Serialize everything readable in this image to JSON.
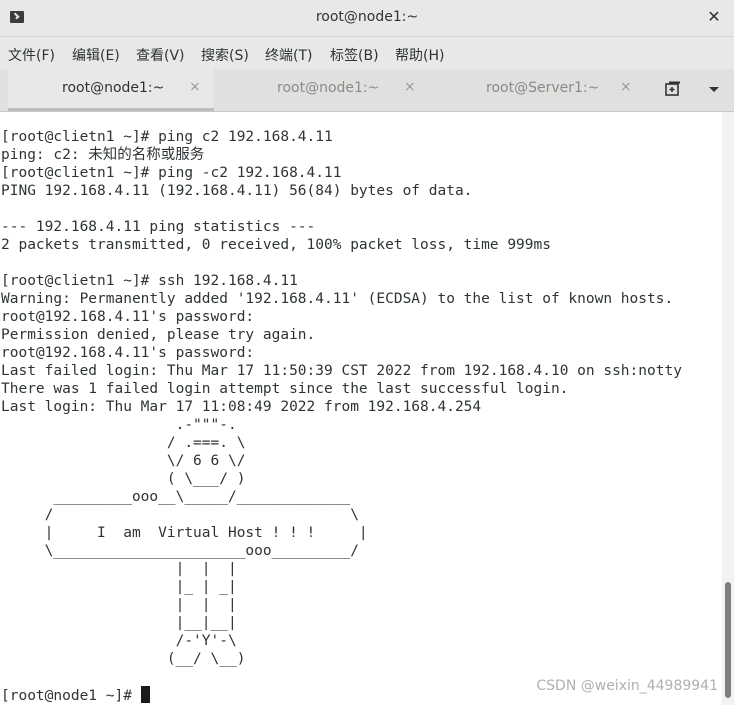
{
  "window": {
    "title": "root@node1:~",
    "close_glyph": "✕"
  },
  "menubar": {
    "items": [
      {
        "label": "文件(F)"
      },
      {
        "label": "编辑(E)"
      },
      {
        "label": "查看(V)"
      },
      {
        "label": "搜索(S)"
      },
      {
        "label": "终端(T)"
      },
      {
        "label": "标签(B)"
      },
      {
        "label": "帮助(H)"
      }
    ]
  },
  "tabs": [
    {
      "label": "root@node1:~",
      "active": true,
      "close_glyph": "×"
    },
    {
      "label": "root@node1:~",
      "active": false,
      "close_glyph": "×"
    },
    {
      "label": "root@Server1:~",
      "active": false,
      "close_glyph": "×"
    }
  ],
  "terminal": {
    "output": "[root@clietn1 ~]# ping c2 192.168.4.11\nping: c2: 未知的名称或服务\n[root@clietn1 ~]# ping -c2 192.168.4.11\nPING 192.168.4.11 (192.168.4.11) 56(84) bytes of data.\n\n--- 192.168.4.11 ping statistics ---\n2 packets transmitted, 0 received, 100% packet loss, time 999ms\n\n[root@clietn1 ~]# ssh 192.168.4.11\nWarning: Permanently added '192.168.4.11' (ECDSA) to the list of known hosts.\nroot@192.168.4.11's password:\nPermission denied, please try again.\nroot@192.168.4.11's password:\nLast failed login: Thu Mar 17 11:50:39 CST 2022 from 192.168.4.10 on ssh:notty\nThere was 1 failed login attempt since the last successful login.\nLast login: Thu Mar 17 11:08:49 2022 from 192.168.4.254\n                    .-\"\"\"-.\n                   / .===. \\\n                   \\/ 6 6 \\/\n                   ( \\___/ )\n      _________ooo__\\_____/_____________\n     /                                  \\\n     |     I  am  Virtual Host ! ! !     |\n     \\______________________ooo_________/\n                    |  |  |\n                    |_ | _|\n                    |  |  |\n                    |__|__|\n                    /-'Y'-\\\n                   (__/ \\__)",
    "prompt": "[root@node1 ~]# "
  },
  "watermark": "CSDN @weixin_44989941",
  "colors": {
    "titlebar_bg": "#e8e8e7",
    "terminal_fg": "#2e3436",
    "terminal_bg": "#ffffff"
  },
  "icons": {
    "app": "terminal-icon",
    "close": "close-icon",
    "new_tab": "new-tab-icon",
    "tabs_menu": "chevron-down-icon"
  }
}
